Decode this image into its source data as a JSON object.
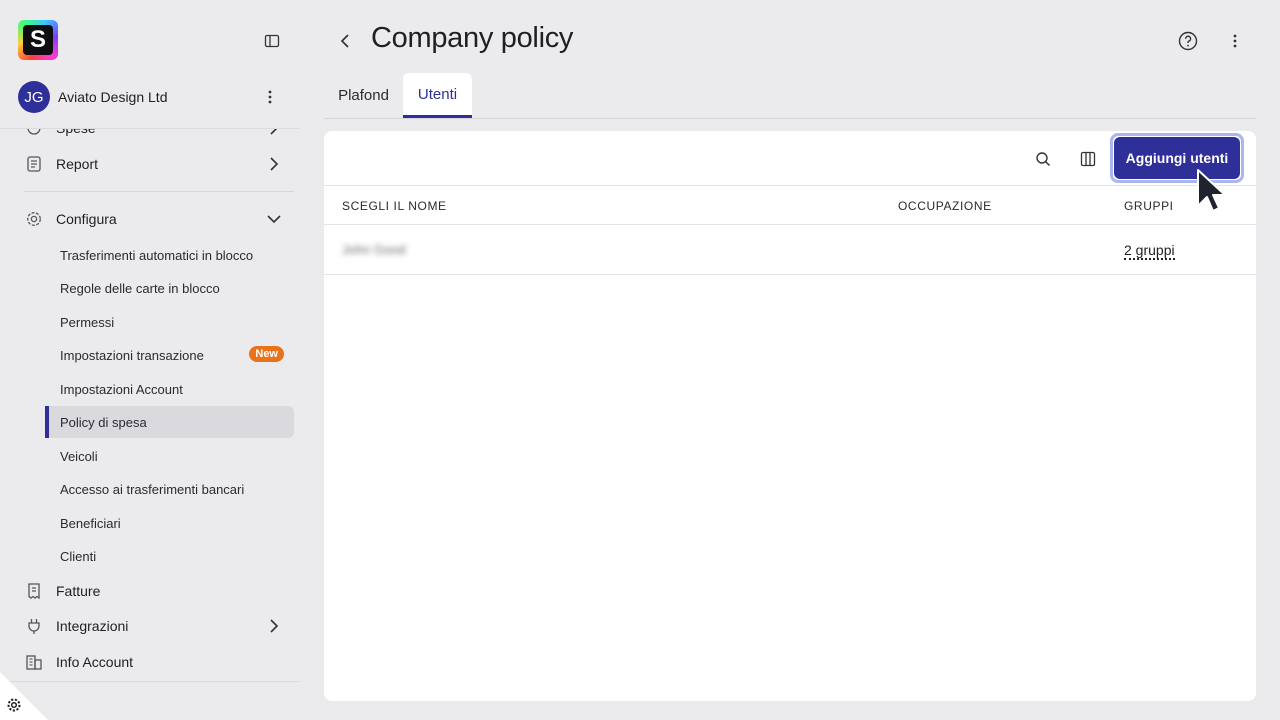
{
  "sidebar": {
    "logo_letter": "S",
    "org": {
      "initials": "JG",
      "name": "Aviato Design Ltd"
    },
    "nav": {
      "spese_label": "Spese",
      "report_label": "Report",
      "configura_label": "Configura",
      "configura_items": [
        {
          "label": "Trasferimenti automatici in blocco"
        },
        {
          "label": "Regole delle carte in blocco"
        },
        {
          "label": "Permessi"
        },
        {
          "label": "Impostazioni transazione",
          "badge": "New"
        },
        {
          "label": "Impostazioni Account"
        },
        {
          "label": "Policy di spesa"
        },
        {
          "label": "Veicoli"
        },
        {
          "label": "Accesso ai trasferimenti bancari"
        },
        {
          "label": "Beneficiari"
        },
        {
          "label": "Clienti"
        }
      ],
      "fatture_label": "Fatture",
      "integrazioni_label": "Integrazioni",
      "info_account_label": "Info Account"
    }
  },
  "header": {
    "title": "Company policy"
  },
  "tabs": [
    {
      "label": "Plafond",
      "active": false
    },
    {
      "label": "Utenti",
      "active": true
    }
  ],
  "toolbar": {
    "add_users_label": "Aggiungi utenti"
  },
  "table": {
    "columns": [
      "SCEGLI IL NOME",
      "OCCUPAZIONE",
      "GRUPPI"
    ],
    "rows": [
      {
        "name": "John Good",
        "occupation": "",
        "groups": "2 gruppi"
      }
    ]
  },
  "colors": {
    "accent": "#2f2f9a",
    "badge": "#e8731a",
    "background": "#ebebed"
  }
}
